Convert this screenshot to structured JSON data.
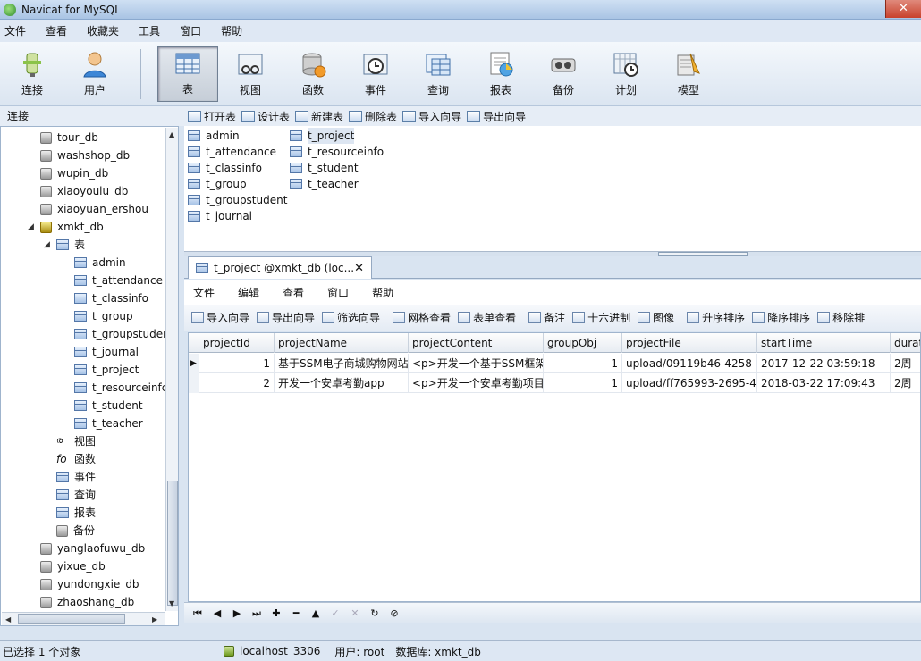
{
  "window": {
    "title": "Navicat for MySQL"
  },
  "menu": [
    "文件",
    "查看",
    "收藏夹",
    "工具",
    "窗口",
    "帮助"
  ],
  "toolbar": [
    {
      "label": "连接",
      "icon": "connection-icon"
    },
    {
      "label": "用户",
      "icon": "user-icon"
    },
    {
      "label": "表",
      "icon": "table-icon",
      "active": true
    },
    {
      "label": "视图",
      "icon": "view-icon"
    },
    {
      "label": "函数",
      "icon": "function-icon"
    },
    {
      "label": "事件",
      "icon": "event-icon"
    },
    {
      "label": "查询",
      "icon": "query-icon"
    },
    {
      "label": "报表",
      "icon": "report-icon"
    },
    {
      "label": "备份",
      "icon": "backup-icon"
    },
    {
      "label": "计划",
      "icon": "schedule-icon"
    },
    {
      "label": "模型",
      "icon": "model-icon"
    }
  ],
  "connection_header": "连接",
  "object_toolbar": [
    "打开表",
    "设计表",
    "新建表",
    "删除表",
    "导入向导",
    "导出向导"
  ],
  "tree": {
    "databases_above": [
      "tour_db",
      "washshop_db",
      "wupin_db",
      "xiaoyoulu_db",
      "xiaoyuan_ershou"
    ],
    "open_db": "xmkt_db",
    "tables_node": "表",
    "tables": [
      "admin",
      "t_attendance",
      "t_classinfo",
      "t_group",
      "t_groupstuder",
      "t_journal",
      "t_project",
      "t_resourceinfc",
      "t_student",
      "t_teacher"
    ],
    "other_nodes": [
      "视图",
      "函数",
      "事件",
      "查询",
      "报表",
      "备份"
    ],
    "databases_below": [
      "yanglaofuwu_db",
      "yixue_db",
      "yundongxie_db",
      "zhaoshang_db"
    ]
  },
  "object_list": {
    "col1": [
      "admin",
      "t_attendance",
      "t_classinfo",
      "t_group",
      "t_groupstudent",
      "t_journal"
    ],
    "col2": [
      "t_project",
      "t_resourceinfo",
      "t_student",
      "t_teacher"
    ],
    "selected": "t_project"
  },
  "tab": {
    "label": "t_project @xmkt_db (loc...",
    "close": "✕"
  },
  "inner_menu": [
    "文件",
    "编辑",
    "查看",
    "窗口",
    "帮助"
  ],
  "inner_toolbar": [
    "导入向导",
    "导出向导",
    "筛选向导",
    "网格查看",
    "表单查看",
    "备注",
    "十六进制",
    "图像",
    "升序排序",
    "降序排序",
    "移除排"
  ],
  "grid": {
    "columns": [
      "projectId",
      "projectName",
      "projectContent",
      "groupObj",
      "projectFile",
      "startTime",
      "durat"
    ],
    "rows": [
      [
        "1",
        "基于SSM电子商城购物网站",
        "<p>开发一个基于SSM框架",
        "1",
        "upload/09119b46-4258-4",
        "2017-12-22 03:59:18",
        "2周"
      ],
      [
        "2",
        "开发一个安卓考勤app",
        "<p>开发一个安卓考勤项目",
        "1",
        "upload/ff765993-2695-44",
        "2018-03-22 17:09:43",
        "2周"
      ]
    ]
  },
  "nav_buttons": [
    "first",
    "prev",
    "next",
    "last",
    "add",
    "delete",
    "up",
    "check",
    "cancel",
    "refresh",
    "stop"
  ],
  "status": {
    "left": "已选择 1 个对象",
    "connection": "localhost_3306",
    "user": "用户: root",
    "database": "数据库: xmkt_db"
  }
}
